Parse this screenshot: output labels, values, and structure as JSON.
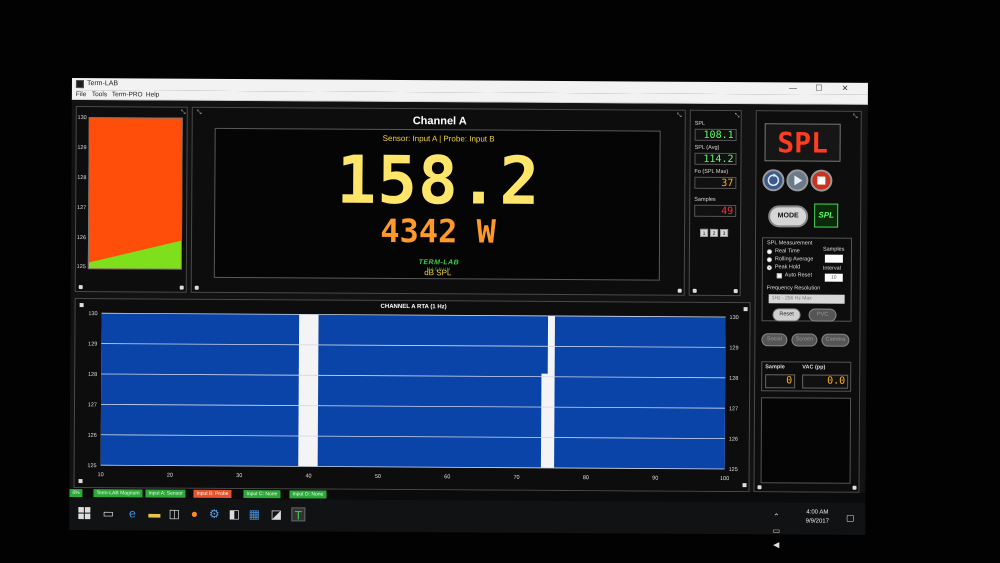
{
  "window": {
    "title": "Term-LAB",
    "menu": [
      "File",
      "Tools",
      "Term-PRO",
      "Help"
    ],
    "minimize": "—",
    "maximize": "☐",
    "close": "✕"
  },
  "meter": {
    "ticks": [
      "130",
      "129",
      "128",
      "127",
      "126",
      "125"
    ],
    "level_fraction": 0.2
  },
  "channel": {
    "title": "Channel A",
    "sensor_line": "Sensor: Input A | Probe: Input B",
    "value": "158.2",
    "power": "4342 W",
    "unit": "dB SPL",
    "logo_line1": "TERM-LAB",
    "logo_line2": "MAGNUM"
  },
  "stats": {
    "spl_label": "SPL",
    "spl_value": "108.1",
    "spl_avg_label": "SPL (Avg)",
    "spl_avg_value": "114.2",
    "fo_label": "Fo (SPL Max)",
    "fo_value": "37",
    "samples_label": "Samples",
    "samples_value": "49",
    "pages": [
      "1",
      "2",
      "3"
    ]
  },
  "control": {
    "display": "SPL",
    "mode_label": "MODE",
    "spl_badge": "SPL",
    "measurement_title": "SPL Measurement",
    "samples_label": "Samples",
    "interval_label": "Interval",
    "interval_value": "10",
    "real_time": "Real Time",
    "rolling_average": "Rolling Average",
    "peak_hold": "Peak Hold",
    "auto_reset": "Auto Reset",
    "freq_title": "Frequency Resolution",
    "freq_value": "1Hz - 256 Hz Max",
    "reset_label": "Reset",
    "pvc_label": "PVC",
    "social_label": "Social",
    "screen_label": "Screen",
    "camera_label": "Camera",
    "sample_label": "Sample",
    "vac_label": "VAC (pp)",
    "sample_value": "0",
    "vac_value": "0.0"
  },
  "chart_data": {
    "type": "bar",
    "title": "CHANNEL A RTA (1 Hz)",
    "x": [
      10,
      20,
      30,
      40,
      50,
      60,
      70,
      80,
      90,
      100
    ],
    "xlim": [
      10,
      100
    ],
    "ylim": [
      125,
      130
    ],
    "y_ticks": [
      130,
      129,
      128,
      127,
      126,
      125
    ],
    "gaps": [
      {
        "from": 38.5,
        "to": 41.3,
        "upto": 130
      },
      {
        "from": 73.5,
        "to": 75,
        "upto": 128.1
      },
      {
        "from": 74.4,
        "to": 75.4,
        "upto": 130
      }
    ],
    "grid": true
  },
  "statusbar": [
    {
      "label": "0%",
      "bg": "#2fa83a",
      "fg": "#e9ffe9"
    },
    {
      "label": "Term-LAB Magnum",
      "bg": "#2fa83a",
      "fg": "#e9ffe9"
    },
    {
      "label": "Input A: Sensor",
      "bg": "#2fa83a",
      "fg": "#e9ffe9"
    },
    {
      "label": "Input B: Probe",
      "bg": "#e8542a",
      "fg": "#fff"
    },
    {
      "label": "Input C: None",
      "bg": "#2fa83a",
      "fg": "#e9ffe9"
    },
    {
      "label": "Input D: None",
      "bg": "#2fa83a",
      "fg": "#e9ffe9"
    }
  ],
  "taskbar": {
    "time": "4:00 AM",
    "date": "9/9/2017"
  },
  "colors": {
    "meter_fill": "#ff4d0a",
    "meter_level": "#7ee01c",
    "rta_bar": "#0a44a8",
    "lcd_green": "#5aff6a",
    "lcd_orange": "#ffb020"
  }
}
